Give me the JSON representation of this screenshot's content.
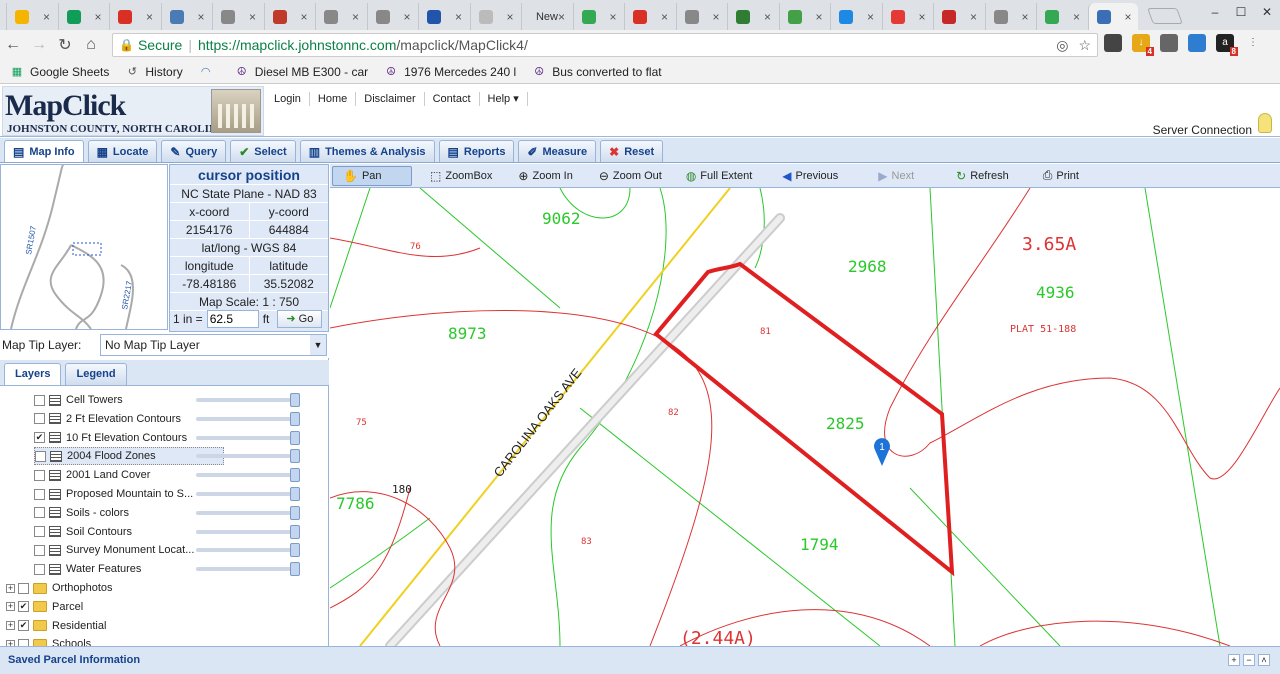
{
  "browser": {
    "tabs": [
      {
        "icon": "drive-icon",
        "color": "#f4b400",
        "text": ""
      },
      {
        "icon": "drive-icon",
        "color": "#0f9d58",
        "text": ""
      },
      {
        "icon": "gmail-icon",
        "color": "#d93025",
        "text": ""
      },
      {
        "icon": "speedometer-icon",
        "color": "#4a7bb5",
        "text": ""
      },
      {
        "icon": "page-icon",
        "color": "#888888",
        "text": ""
      },
      {
        "icon": "flower-icon",
        "color": "#c03a2b",
        "text": ""
      },
      {
        "icon": "page-icon",
        "color": "#888888",
        "text": ""
      },
      {
        "icon": "page-icon",
        "color": "#888888",
        "text": ""
      },
      {
        "icon": "swirl-icon",
        "color": "#2255aa",
        "text": ""
      },
      {
        "icon": "w-icon",
        "color": "#bbbbbb",
        "text": ""
      },
      {
        "icon": "new-tab-icon",
        "color": "#dee1e6",
        "text": "New"
      },
      {
        "icon": "maps-icon",
        "color": "#34a853",
        "text": ""
      },
      {
        "icon": "shield-icon",
        "color": "#d93025",
        "text": ""
      },
      {
        "icon": "page-icon",
        "color": "#888888",
        "text": ""
      },
      {
        "icon": "globe-icon",
        "color": "#2e7d32",
        "text": ""
      },
      {
        "icon": "badge-icon",
        "color": "#43a047",
        "text": ""
      },
      {
        "icon": "windows-icon",
        "color": "#1e88e5",
        "text": ""
      },
      {
        "icon": "adobe-icon",
        "color": "#e53935",
        "text": ""
      },
      {
        "icon": "circle-icon",
        "color": "#c62828",
        "text": ""
      },
      {
        "icon": "page-icon",
        "color": "#888888",
        "text": ""
      },
      {
        "icon": "maps-icon",
        "color": "#34a853",
        "text": ""
      },
      {
        "icon": "globe-icon",
        "color": "#3b6fb5",
        "text": ""
      }
    ],
    "secure_label": "Secure",
    "url_host": "https://mapclick.johnstonnc.com",
    "url_path": "/mapclick/MapClick4/",
    "bookmarks": [
      {
        "icon": "sheets-icon",
        "label": "Google Sheets"
      },
      {
        "icon": "history-icon",
        "label": "History"
      },
      {
        "icon": "speedometer-icon",
        "label": ""
      },
      {
        "icon": "peace-icon",
        "label": "Diesel MB E300 - car"
      },
      {
        "icon": "peace-icon",
        "label": "1976 Mercedes 240 l"
      },
      {
        "icon": "peace-icon",
        "label": "Bus converted to flat"
      }
    ],
    "ext_badges": {
      "download": "4",
      "amazon": "8"
    }
  },
  "app": {
    "logo_title": "MapClick",
    "logo_subtitle": "JOHNSTON COUNTY, NORTH CAROLINA",
    "topnav": [
      "Login",
      "Home",
      "Disclaimer",
      "Contact",
      "Help ▾"
    ],
    "server_connection": "Server Connection",
    "main_tabs": [
      {
        "icon": "map-info-icon",
        "label": "Map Info",
        "active": true
      },
      {
        "icon": "locate-icon",
        "label": "Locate"
      },
      {
        "icon": "query-icon",
        "label": "Query"
      },
      {
        "icon": "select-icon",
        "label": "Select"
      },
      {
        "icon": "themes-icon",
        "label": "Themes & Analysis"
      },
      {
        "icon": "reports-icon",
        "label": "Reports"
      },
      {
        "icon": "measure-icon",
        "label": "Measure"
      },
      {
        "icon": "reset-icon",
        "label": "Reset"
      }
    ]
  },
  "cursor_position": {
    "title": "cursor position",
    "plane": "NC State Plane - NAD 83",
    "x_label": "x-coord",
    "y_label": "y-coord",
    "x_value": "2154176",
    "y_value": "644884",
    "latlong_label": "lat/long - WGS 84",
    "lon_label": "longitude",
    "lat_label": "latitude",
    "lon_value": "-78.48186",
    "lat_value": "35.52082",
    "map_scale": "Map Scale:  1 : 750",
    "scale_prefix": "1 in =",
    "scale_value": "62.5",
    "scale_unit": "ft",
    "go_label": "Go"
  },
  "overview": {
    "road_labels": [
      "SR1507",
      "SR2217"
    ]
  },
  "map_tip": {
    "label": "Map Tip Layer:",
    "value": "No Map Tip Layer"
  },
  "layer_tabs": [
    "Layers",
    "Legend"
  ],
  "layers": [
    {
      "label": "Cell Towers",
      "checked": false,
      "type": "layer"
    },
    {
      "label": "2 Ft Elevation Contours",
      "checked": false,
      "type": "layer"
    },
    {
      "label": "10 Ft Elevation Contours",
      "checked": true,
      "type": "layer"
    },
    {
      "label": "2004 Flood Zones",
      "checked": false,
      "type": "layer",
      "selected": true
    },
    {
      "label": "2001 Land Cover",
      "checked": false,
      "type": "layer"
    },
    {
      "label": "Proposed Mountain to S...",
      "checked": false,
      "type": "layer"
    },
    {
      "label": "Soils - colors",
      "checked": false,
      "type": "layer"
    },
    {
      "label": "Soil Contours",
      "checked": false,
      "type": "layer"
    },
    {
      "label": "Survey Monument Locat...",
      "checked": false,
      "type": "layer"
    },
    {
      "label": "Water Features",
      "checked": false,
      "type": "layer"
    },
    {
      "label": "Orthophotos",
      "checked": false,
      "type": "group"
    },
    {
      "label": "Parcel",
      "checked": true,
      "type": "group"
    },
    {
      "label": "Residential",
      "checked": true,
      "type": "group"
    },
    {
      "label": "Schools",
      "checked": false,
      "type": "group"
    }
  ],
  "map_toolbar": [
    {
      "icon": "hand-icon",
      "label": "Pan",
      "active": true
    },
    {
      "icon": "zoombox-icon",
      "label": "ZoomBox"
    },
    {
      "icon": "zoom-in-icon",
      "label": "Zoom In"
    },
    {
      "icon": "zoom-out-icon",
      "label": "Zoom Out"
    },
    {
      "icon": "globe-icon",
      "label": "Full Extent"
    },
    {
      "icon": "arrow-left-icon",
      "label": "Previous"
    },
    {
      "icon": "arrow-right-icon",
      "label": "Next",
      "disabled": true
    },
    {
      "icon": "refresh-icon",
      "label": "Refresh"
    },
    {
      "icon": "print-icon",
      "label": "Print"
    }
  ],
  "map": {
    "street_label": "CAROLINA OAKS AVE",
    "parcel_labels_green": [
      "9062",
      "2968",
      "4936",
      "8973",
      "2825",
      "1794",
      "7786"
    ],
    "parcel_labels_red": [
      "3.65A",
      "PLAT 51-188",
      "76",
      "81",
      "82",
      "75",
      "83",
      "180",
      "(2.44A)"
    ],
    "marker_label": "1",
    "colors": {
      "parcel": "#e02020",
      "contour": "#d33",
      "boundary": "#22c422",
      "road": "#f0d020"
    }
  },
  "footer": {
    "title": "Saved Parcel Information"
  }
}
